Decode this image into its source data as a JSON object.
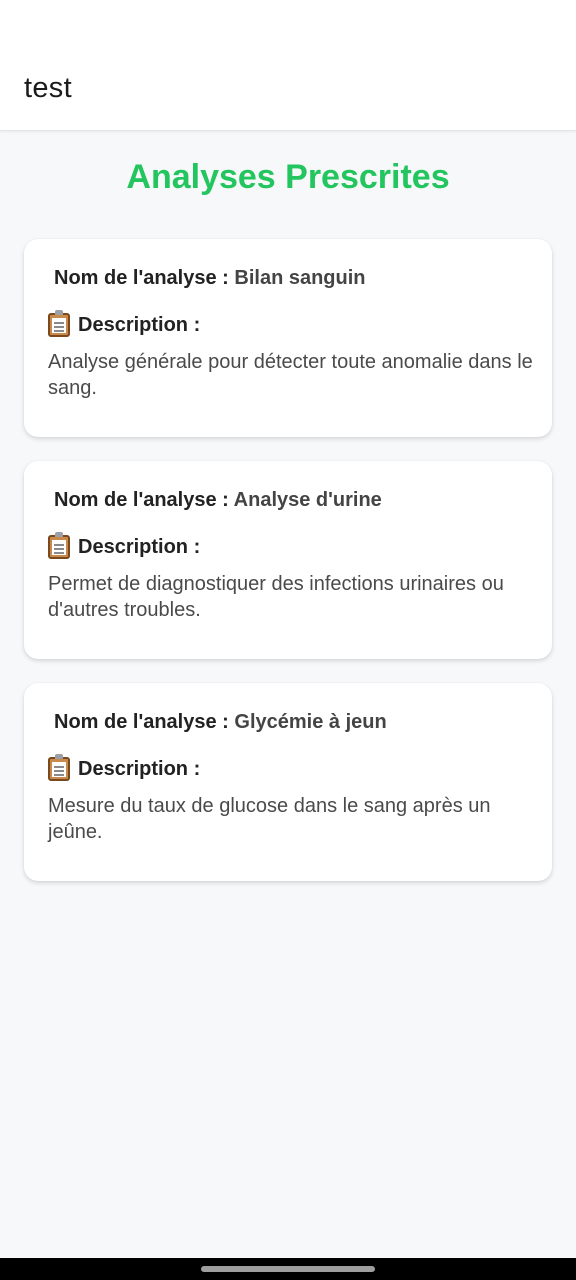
{
  "app_bar": {
    "title": "test"
  },
  "page": {
    "heading": "Analyses Prescrites",
    "accent_color": "#22c55e"
  },
  "analyses": [
    {
      "name_label": "Nom de l'analyse :",
      "name_value": "Bilan sanguin",
      "desc_icon": "clipboard-icon",
      "desc_label": "Description :",
      "description": "Analyse générale pour détecter toute anomalie dans le sang."
    },
    {
      "name_label": "Nom de l'analyse :",
      "name_value": "Analyse d'urine",
      "desc_icon": "clipboard-icon",
      "desc_label": "Description :",
      "description": "Permet de diagnostiquer des infections urinaires ou d'autres troubles."
    },
    {
      "name_label": "Nom de l'analyse :",
      "name_value": "Glycémie à jeun",
      "desc_icon": "clipboard-icon",
      "desc_label": "Description :",
      "description": "Mesure du taux de glucose dans le sang après un jeûne."
    }
  ]
}
